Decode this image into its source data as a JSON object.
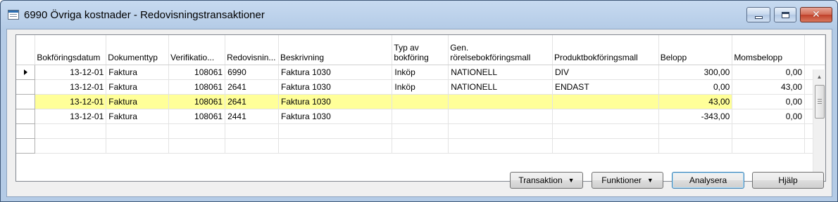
{
  "window": {
    "title": "6990 Övriga kostnader - Redovisningstransaktioner",
    "controls": {
      "minimize": "minimize-icon",
      "maximize": "maximize-icon",
      "close": "close-icon"
    }
  },
  "grid": {
    "columns": [
      "Bokföringsdatum",
      "Dokumenttyp",
      "Verifikatio...",
      "Redovisnin...",
      "Beskrivning",
      "Typ av bokföring",
      "Gen. rörelsebokföringsmall",
      "Produktbokföringsmall",
      "Belopp",
      "Momsbelopp"
    ],
    "rows": [
      {
        "date": "13-12-01",
        "doctype": "Faktura",
        "verif": "108061",
        "account": "6990",
        "desc": "Faktura 1030",
        "type": "Inköp",
        "gen": "NATIONELL",
        "prod": "DIV",
        "amount": "300,00",
        "vat": "0,00",
        "current": true,
        "highlight": false
      },
      {
        "date": "13-12-01",
        "doctype": "Faktura",
        "verif": "108061",
        "account": "2641",
        "desc": "Faktura 1030",
        "type": "Inköp",
        "gen": "NATIONELL",
        "prod": "ENDAST",
        "amount": "0,00",
        "vat": "43,00",
        "current": false,
        "highlight": false
      },
      {
        "date": "13-12-01",
        "doctype": "Faktura",
        "verif": "108061",
        "account": "2641",
        "desc": "Faktura 1030",
        "type": "",
        "gen": "",
        "prod": "",
        "amount": "43,00",
        "vat": "0,00",
        "current": false,
        "highlight": true
      },
      {
        "date": "13-12-01",
        "doctype": "Faktura",
        "verif": "108061",
        "account": "2441",
        "desc": "Faktura 1030",
        "type": "",
        "gen": "",
        "prod": "",
        "amount": "-343,00",
        "vat": "0,00",
        "current": false,
        "highlight": false
      }
    ],
    "empty_rows": 2,
    "highlight_color": "#ffff99"
  },
  "buttons": {
    "transaktion": "Transaktion",
    "funktioner": "Funktioner",
    "analysera": "Analysera",
    "hjalp": "Hjälp"
  }
}
